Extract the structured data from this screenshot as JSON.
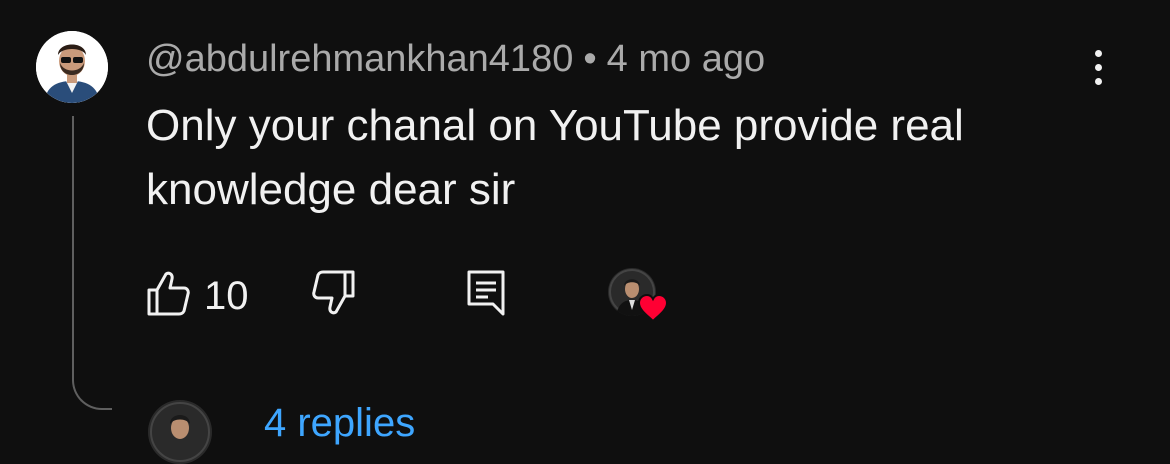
{
  "comment": {
    "author": "@abdulrehmankhan4180",
    "separator": "•",
    "time_ago": "4 mo ago",
    "text_line1": "Only your chanal on YouTube provide real",
    "text_line2": "knowledge dear sir",
    "like_count": "10",
    "creator_hearted": true
  },
  "replies": {
    "label": "4 replies"
  },
  "colors": {
    "background": "#0f0f0f",
    "primary_text": "#f1f1f1",
    "secondary_text": "#aaaaaa",
    "heart": "#ff0033",
    "replies_link": "#3ea6ff"
  },
  "icons": [
    "more-vert-icon",
    "thumb-up-icon",
    "thumb-down-icon",
    "comment-icon",
    "heart-icon"
  ]
}
